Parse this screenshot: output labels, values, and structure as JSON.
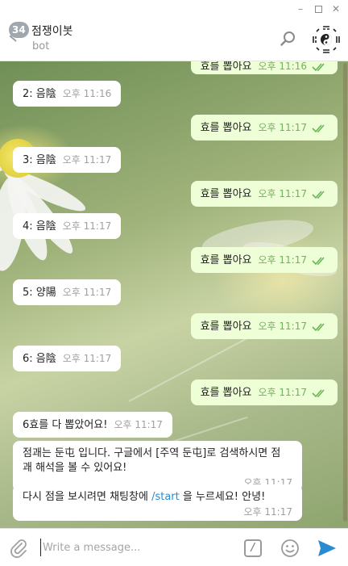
{
  "window": {
    "minimize": "–",
    "close": "✕"
  },
  "header": {
    "unread_count": "34",
    "title": "점쟁이봇",
    "subtitle": "bot",
    "accent": "#2b8bd1"
  },
  "messages": [
    {
      "from": "out",
      "text": "효를 뽑아요",
      "time": "오후 11:16"
    },
    {
      "from": "in",
      "text": "2: 음陰",
      "time": "오후 11:16"
    },
    {
      "from": "out",
      "text": "효를 뽑아요",
      "time": "오후 11:17"
    },
    {
      "from": "in",
      "text": "3: 음陰",
      "time": "오후 11:17"
    },
    {
      "from": "out",
      "text": "효를 뽑아요",
      "time": "오후 11:17"
    },
    {
      "from": "in",
      "text": "4: 음陰",
      "time": "오후 11:17"
    },
    {
      "from": "out",
      "text": "효를 뽑아요",
      "time": "오후 11:17"
    },
    {
      "from": "in",
      "text": "5: 양陽",
      "time": "오후 11:17"
    },
    {
      "from": "out",
      "text": "효를 뽑아요",
      "time": "오후 11:17"
    },
    {
      "from": "in",
      "text": "6: 음陰",
      "time": "오후 11:17"
    },
    {
      "from": "out",
      "text": "효를 뽑아요",
      "time": "오후 11:17"
    },
    {
      "from": "in",
      "text": "6효를 다 뽑았어요!",
      "time": "오후 11:17"
    },
    {
      "from": "in",
      "line1": "점괘는 둔屯 입니다. 구글에서 [주역 둔屯]로 검색하시면 점",
      "line2": "괘 해석을 볼 수 있어요!",
      "time": "오후 11:17"
    },
    {
      "from": "in",
      "text_before": "다시 점을 보시려면 채팅창에 ",
      "command": "/start",
      "text_after": " 을 누르세요! 안녕!",
      "time": "오후 11:17"
    }
  ],
  "composer": {
    "placeholder": "Write a message...",
    "value": "",
    "command_icon": "/"
  },
  "colors": {
    "outgoing_bubble": "#eefed6",
    "incoming_bubble": "#ffffff",
    "read_check": "#6cb559",
    "send": "#2b8bd1"
  }
}
